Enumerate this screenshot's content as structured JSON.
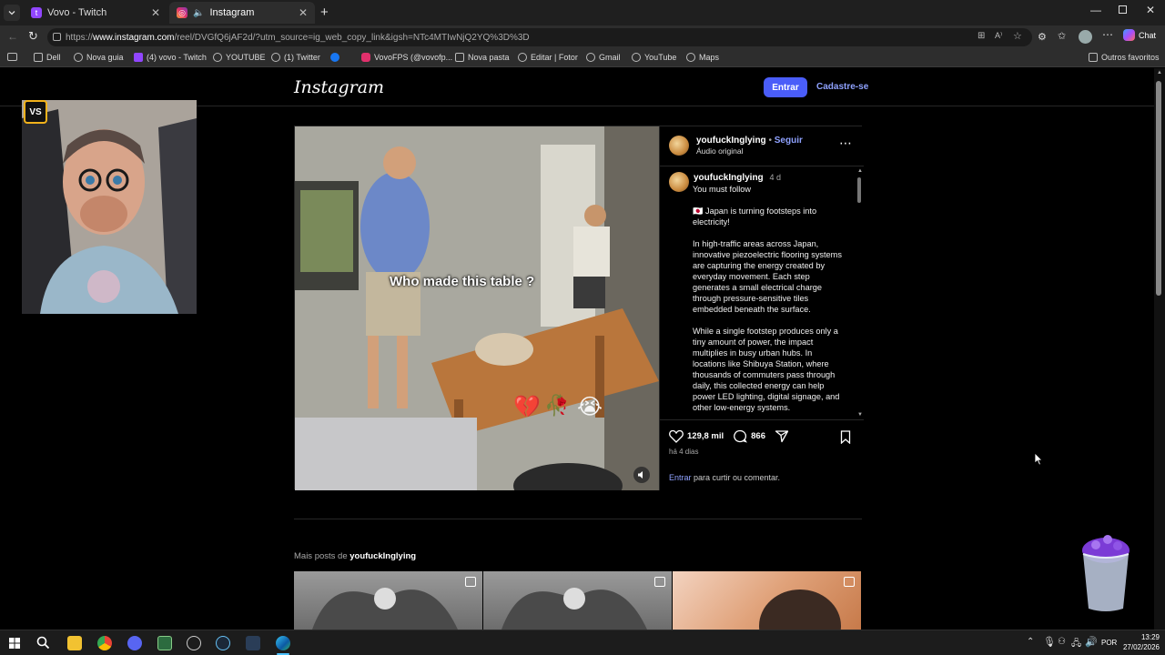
{
  "tabs": [
    {
      "title": "Vovo - Twitch",
      "active": false
    },
    {
      "title": "Instagram",
      "active": true
    }
  ],
  "address": {
    "url_prefix": "https://",
    "url_domain": "www.instagram.com",
    "url_path": "/reel/DVGfQ6jAF2d/?utm_source=ig_web_copy_link&igsh=NTc4MTIwNjQ2YQ%3D%3D"
  },
  "chat_label": "Chat",
  "bookmarks": [
    {
      "label": "Dell",
      "icon": "folder-icon"
    },
    {
      "label": "Nova guia",
      "icon": "globe-icon"
    },
    {
      "label": "(4) vovo - Twitch",
      "icon": "twitch-icon"
    },
    {
      "label": "YOUTUBE",
      "icon": "globe-icon"
    },
    {
      "label": "(1) Twitter",
      "icon": "globe-icon"
    },
    {
      "label": "",
      "icon": "facebook-icon"
    },
    {
      "label": "VovoFPS (@vovofp...",
      "icon": "instagram-icon"
    },
    {
      "label": "Nova pasta",
      "icon": "folder-icon"
    },
    {
      "label": "Editar | Fotor",
      "icon": "globe-icon"
    },
    {
      "label": "Gmail",
      "icon": "globe-icon"
    },
    {
      "label": "YouTube",
      "icon": "globe-icon"
    },
    {
      "label": "Maps",
      "icon": "globe-icon"
    }
  ],
  "other_favorites": "Outros favoritos",
  "ig": {
    "logo": "Instagram",
    "login_label": "Entrar",
    "signup_label": "Cadastre-se",
    "post": {
      "video_overlay_text": "Who made this table ?",
      "username": "youfuckInglying",
      "follow": "Seguir",
      "separator": "•",
      "audio": "Áudio original",
      "caption_username": "youfuckInglying",
      "caption_age": "4 d",
      "caption_lines": [
        "You must follow",
        "🇯🇵 Japan is turning footsteps into electricity!",
        "In high-traffic areas across Japan, innovative piezoelectric flooring systems are capturing the energy created by everyday movement. Each step generates a small electrical charge through pressure-sensitive tiles embedded beneath the surface.",
        "While a single footstep produces only a tiny amount of power, the impact multiplies in busy urban hubs. In locations like Shibuya Station, where thousands of commuters pass through daily, this collected energy can help power LED lighting, digital signage, and other low-energy systems."
      ],
      "likes": "129,8 mil",
      "comments": "866",
      "posted_ago": "há 4 dias",
      "login_prompt_link": "Entrar",
      "login_prompt_rest": " para curtir ou comentar."
    },
    "more_posts_prefix": "Mais posts de ",
    "more_posts_user": "youfuckInglying"
  },
  "system": {
    "language": "POR",
    "time": "13:29",
    "date": "27/02/2026"
  },
  "colors": {
    "accent": "#4a5df9",
    "link": "#8fa2ff",
    "background": "#000000"
  }
}
